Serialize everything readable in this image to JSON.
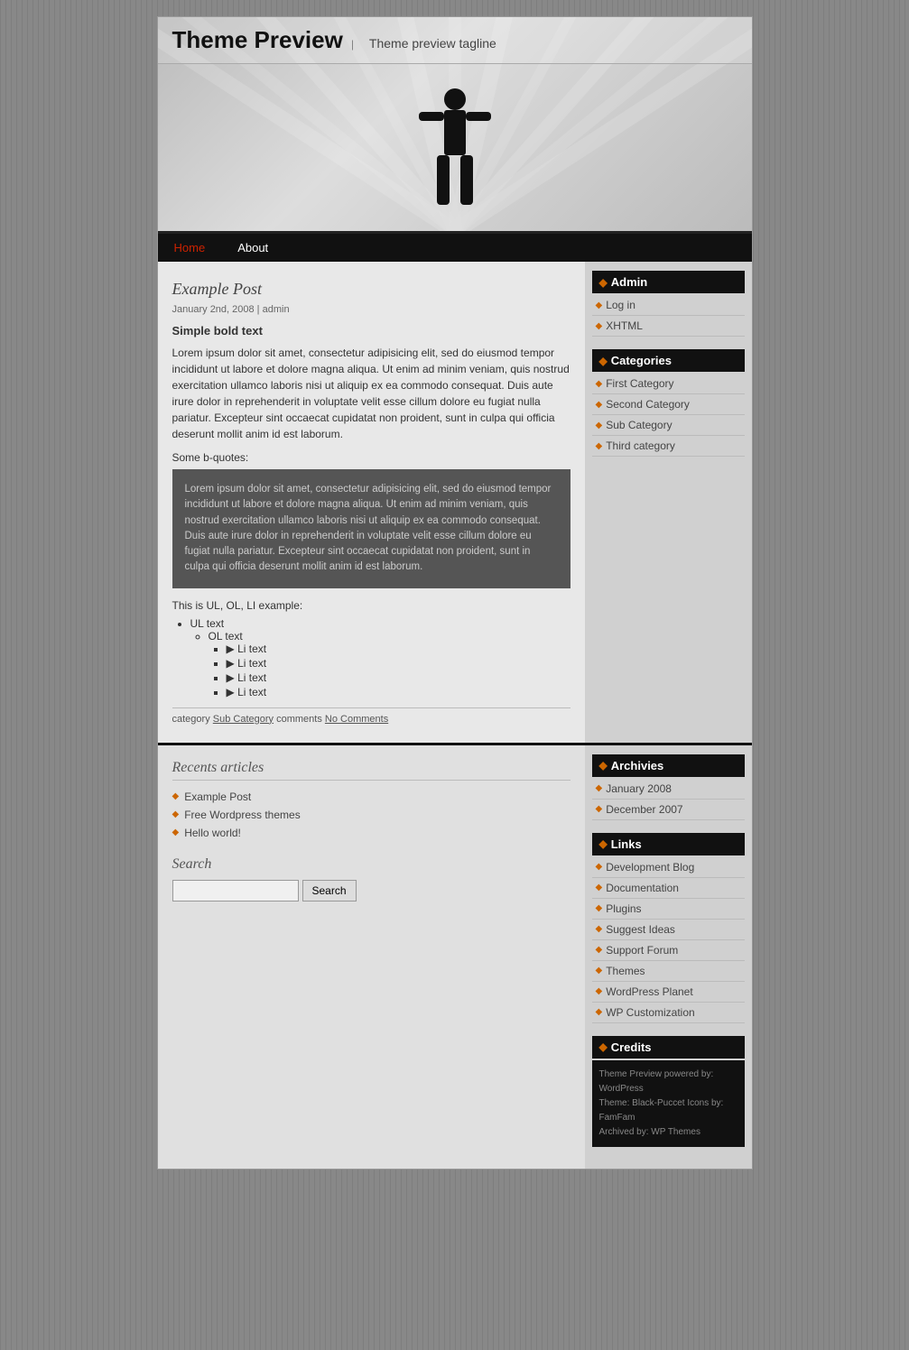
{
  "site": {
    "title": "Theme Preview",
    "separator": "|",
    "tagline": "Theme preview tagline"
  },
  "nav": {
    "items": [
      {
        "label": "Home",
        "active": true
      },
      {
        "label": "About",
        "active": false
      }
    ]
  },
  "post": {
    "title": "Example Post",
    "meta": "January 2nd, 2008 | admin",
    "bold_text": "Simple bold text",
    "body": "Lorem ipsum dolor sit amet, consectetur adipisicing elit, sed do eiusmod tempor incididunt ut labore et dolore magna aliqua. Ut enim ad minim veniam, quis nostrud exercitation ullamco laboris nisi ut aliquip ex ea commodo consequat. Duis aute irure dolor in reprehenderit in voluptate velit esse cillum dolore eu fugiat nulla pariatur. Excepteur sint occaecat cupidatat non proident, sunt in culpa qui officia deserunt mollit anim id est laborum.",
    "bquotes_label": "Some b-quotes:",
    "blockquote": "Lorem ipsum dolor sit amet, consectetur adipisicing elit, sed do eiusmod tempor incididunt ut labore et dolore magna aliqua. Ut enim ad minim veniam, quis nostrud exercitation ullamco laboris nisi ut aliquip ex ea commodo consequat. Duis aute irure dolor in reprehenderit in voluptate velit esse cillum dolore eu fugiat nulla pariatur. Excepteur sint occaecat cupidatat non proident, sunt in culpa qui officia deserunt mollit anim id est laborum.",
    "ul_ol_label": "This is UL, OL, LI example:",
    "ul_text": "UL text",
    "ol_text": "OL text",
    "li_items": [
      "Li text",
      "Li text",
      "Li text",
      "Li text"
    ],
    "footer_category": "category",
    "footer_category_link": "Sub Category",
    "footer_comments": "comments",
    "footer_comments_link": "No Comments"
  },
  "sidebar": {
    "admin_title": "Admin",
    "admin_items": [
      {
        "label": "Log in"
      },
      {
        "label": "XHTML"
      }
    ],
    "categories_title": "Categories",
    "categories": [
      {
        "label": "First Category",
        "sub": []
      },
      {
        "label": "Second Category",
        "sub": [
          {
            "label": "Sub Category"
          }
        ]
      },
      {
        "label": "Third category",
        "sub": []
      }
    ]
  },
  "footer": {
    "recents_title": "Recents articles",
    "recent_items": [
      {
        "label": "Example Post"
      },
      {
        "label": "Free Wordpress themes"
      },
      {
        "label": "Hello world!"
      }
    ],
    "search_title": "Search",
    "search_placeholder": "",
    "search_button": "Search",
    "archivies_title": "Archivies",
    "archives": [
      {
        "label": "January 2008"
      },
      {
        "label": "December 2007"
      }
    ],
    "links_title": "Links",
    "links": [
      {
        "label": "Development Blog"
      },
      {
        "label": "Documentation"
      },
      {
        "label": "Plugins"
      },
      {
        "label": "Suggest Ideas"
      },
      {
        "label": "Support Forum"
      },
      {
        "label": "Themes"
      },
      {
        "label": "WordPress Planet"
      },
      {
        "label": "WP Customization"
      }
    ],
    "credits_title": "Credits",
    "credits_line1": "Theme Preview powered by: WordPress",
    "credits_line2": "Theme: Black-Puccet  Icons by: FamFam",
    "credits_line3": "Archived by: WP Themes"
  }
}
